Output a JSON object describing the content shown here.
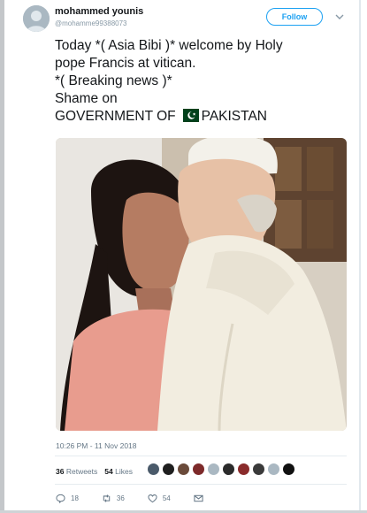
{
  "tweet": {
    "author": {
      "name": "mohammed younis",
      "handle": "@mohamme99388073"
    },
    "follow_label": "Follow",
    "text": {
      "line1": "Today *( Asia Bibi )* welcome by Holy",
      "line2": "pope Francis at vitican.",
      "line3": "*( Breaking news )*",
      "line4": "Shame on",
      "line5_before_flag": "GOVERNMENT OF",
      "line5_after_flag": "PAKISTAN"
    },
    "timestamp": "10:26 PM - 11 Nov 2018",
    "stats": {
      "retweets_count": "36",
      "retweets_label": "Retweets",
      "likes_count": "54",
      "likes_label": "Likes"
    },
    "likers_count_shown": 10,
    "actions": {
      "reply_count": "18",
      "retweet_count": "36",
      "like_count": "54"
    }
  },
  "icons": {
    "flag": "pakistan-flag-icon",
    "reply": "reply-icon",
    "retweet": "retweet-icon",
    "like": "heart-icon",
    "message": "envelope-icon",
    "menu": "chevron-down-icon"
  },
  "colors": {
    "accent": "#1da1f2",
    "text": "#14171a",
    "muted": "#657786"
  }
}
